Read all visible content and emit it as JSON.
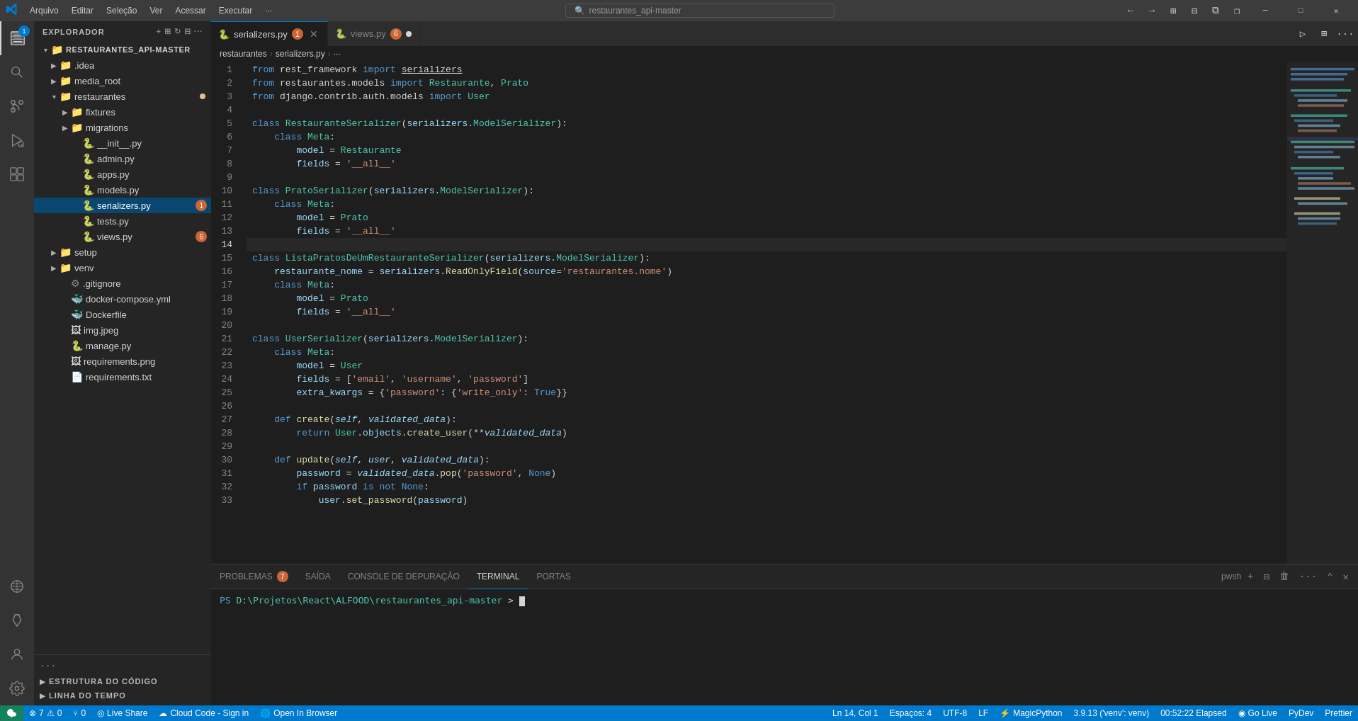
{
  "titlebar": {
    "logo": "⬡",
    "menu_items": [
      "Arquivo",
      "Editar",
      "Seleção",
      "Ver",
      "Acessar",
      "Executar",
      "···"
    ],
    "search_placeholder": "restaurantes_api-master",
    "back_label": "←",
    "forward_label": "→",
    "controls": [
      "⊞",
      "⊟",
      "⧉",
      "❐"
    ],
    "minimize": "─",
    "maximize": "□",
    "close": "✕"
  },
  "activity_bar": {
    "items": [
      {
        "name": "explorer",
        "icon": "⊡",
        "active": true,
        "badge": "1"
      },
      {
        "name": "search",
        "icon": "🔍",
        "active": false
      },
      {
        "name": "source-control",
        "icon": "⑂",
        "active": false
      },
      {
        "name": "run-debug",
        "icon": "▷",
        "active": false
      },
      {
        "name": "extensions",
        "icon": "⊞",
        "active": false
      },
      {
        "name": "remote",
        "icon": "◎",
        "active": false
      },
      {
        "name": "testing",
        "icon": "⚗",
        "active": false
      },
      {
        "name": "accounts",
        "icon": "◉",
        "active": false
      },
      {
        "name": "settings",
        "icon": "⚙",
        "active": false
      }
    ]
  },
  "sidebar": {
    "title": "EXPLORADOR",
    "root_folder": "RESTAURANTES_API-MASTER",
    "tree": [
      {
        "id": "idea",
        "label": ".idea",
        "type": "folder",
        "indent": 1,
        "expanded": false
      },
      {
        "id": "media_root",
        "label": "media_root",
        "type": "folder",
        "indent": 1,
        "expanded": false
      },
      {
        "id": "restaurantes",
        "label": "restaurantes",
        "type": "folder",
        "indent": 1,
        "expanded": true,
        "dot": true
      },
      {
        "id": "fixtures",
        "label": "fixtures",
        "type": "folder",
        "indent": 2,
        "expanded": false
      },
      {
        "id": "migrations",
        "label": "migrations",
        "type": "folder",
        "indent": 2,
        "expanded": false
      },
      {
        "id": "__init__",
        "label": "__init__.py",
        "type": "py",
        "indent": 2
      },
      {
        "id": "admin",
        "label": "admin.py",
        "type": "py",
        "indent": 2
      },
      {
        "id": "apps",
        "label": "apps.py",
        "type": "py",
        "indent": 2
      },
      {
        "id": "models",
        "label": "models.py",
        "type": "py",
        "indent": 2
      },
      {
        "id": "serializers",
        "label": "serializers.py",
        "type": "py",
        "indent": 2,
        "badge": "1",
        "selected": true
      },
      {
        "id": "tests",
        "label": "tests.py",
        "type": "py",
        "indent": 2
      },
      {
        "id": "views",
        "label": "views.py",
        "type": "py",
        "indent": 2,
        "badge": "6"
      },
      {
        "id": "setup",
        "label": "setup",
        "type": "folder",
        "indent": 1,
        "expanded": false
      },
      {
        "id": "venv",
        "label": "venv",
        "type": "folder",
        "indent": 1,
        "expanded": false
      },
      {
        "id": "gitignore",
        "label": ".gitignore",
        "type": "git",
        "indent": 1
      },
      {
        "id": "docker-compose",
        "label": "docker-compose.yml",
        "type": "docker",
        "indent": 1
      },
      {
        "id": "dockerfile",
        "label": "Dockerfile",
        "type": "docker",
        "indent": 1
      },
      {
        "id": "img",
        "label": "img.jpeg",
        "type": "img",
        "indent": 1
      },
      {
        "id": "manage",
        "label": "manage.py",
        "type": "py",
        "indent": 1
      },
      {
        "id": "requirements-png",
        "label": "requirements.png",
        "type": "img",
        "indent": 1
      },
      {
        "id": "requirements-txt",
        "label": "requirements.txt",
        "type": "txt",
        "indent": 1
      }
    ],
    "bottom_sections": [
      {
        "id": "code-structure",
        "label": "ESTRUTURA DO CÓDIGO",
        "expanded": false
      },
      {
        "id": "timeline",
        "label": "LINHA DO TEMPO",
        "expanded": false
      }
    ]
  },
  "tabs": [
    {
      "id": "serializers",
      "label": "serializers.py",
      "badge": "1",
      "active": true,
      "icon": "🐍"
    },
    {
      "id": "views",
      "label": "views.py",
      "badge": "6",
      "active": false,
      "icon": "🐍",
      "dot": true
    }
  ],
  "breadcrumb": {
    "items": [
      "restaurantes",
      "serializers.py",
      "···"
    ]
  },
  "editor": {
    "current_line": 14,
    "lines": [
      {
        "num": 1,
        "code": "from rest_framework import <u>serializers</u>"
      },
      {
        "num": 2,
        "code": "from restaurantes.models import Restaurante, Prato"
      },
      {
        "num": 3,
        "code": "from django.contrib.auth.models import User"
      },
      {
        "num": 4,
        "code": ""
      },
      {
        "num": 5,
        "code": "class RestauranteSerializer(serializers.ModelSerializer):"
      },
      {
        "num": 6,
        "code": "    class Meta:"
      },
      {
        "num": 7,
        "code": "        model = Restaurante"
      },
      {
        "num": 8,
        "code": "        fields = '__all__'"
      },
      {
        "num": 9,
        "code": ""
      },
      {
        "num": 10,
        "code": "class PratoSerializer(serializers.ModelSerializer):"
      },
      {
        "num": 11,
        "code": "    class Meta:"
      },
      {
        "num": 12,
        "code": "        model = Prato"
      },
      {
        "num": 13,
        "code": "        fields = '__all__'"
      },
      {
        "num": 14,
        "code": ""
      },
      {
        "num": 15,
        "code": "class ListaPratosDeUmRestauranteSerializer(serializers.ModelSerializer):"
      },
      {
        "num": 16,
        "code": "    restaurante_nome = serializers.ReadOnlyField(source='restaurantes.nome')"
      },
      {
        "num": 17,
        "code": "    class Meta:"
      },
      {
        "num": 18,
        "code": "        model = Prato"
      },
      {
        "num": 19,
        "code": "        fields = '__all__'"
      },
      {
        "num": 20,
        "code": ""
      },
      {
        "num": 21,
        "code": "class UserSerializer(serializers.ModelSerializer):"
      },
      {
        "num": 22,
        "code": "    class Meta:"
      },
      {
        "num": 23,
        "code": "        model = User"
      },
      {
        "num": 24,
        "code": "        fields = ['email', 'username', 'password']"
      },
      {
        "num": 25,
        "code": "        extra_kwargs = {'password': {'write_only': True}}"
      },
      {
        "num": 26,
        "code": ""
      },
      {
        "num": 27,
        "code": "    def create(self, validated_data):"
      },
      {
        "num": 28,
        "code": "        return User.objects.create_user(**validated_data)"
      },
      {
        "num": 29,
        "code": ""
      },
      {
        "num": 30,
        "code": "    def update(self, user, validated_data):"
      },
      {
        "num": 31,
        "code": "        password = validated_data.pop('password', None)"
      },
      {
        "num": 32,
        "code": "        if password is not None:"
      },
      {
        "num": 33,
        "code": "            user.set_password(password)"
      }
    ]
  },
  "panel": {
    "tabs": [
      {
        "id": "problems",
        "label": "PROBLEMAS",
        "badge": "7"
      },
      {
        "id": "output",
        "label": "SAÍDA"
      },
      {
        "id": "debug-console",
        "label": "CONSOLE DE DEPURAÇÃO"
      },
      {
        "id": "terminal",
        "label": "TERMINAL",
        "active": true
      },
      {
        "id": "ports",
        "label": "PORTAS"
      }
    ],
    "terminal_shell": "pwsh",
    "terminal_content": "PS D:\\Projetos\\React\\ALFOOD\\restaurantes_api-master>"
  },
  "status_bar": {
    "left_items": [
      {
        "id": "remote",
        "icon": "⬡",
        "label": "",
        "bg": "#16825d"
      },
      {
        "id": "errors",
        "icon": "⊗",
        "label": "7",
        "extra": "⚠",
        "extra_label": "0"
      },
      {
        "id": "source-control",
        "icon": "⑂",
        "label": "0"
      }
    ],
    "right_items": [
      {
        "id": "cursor",
        "label": "Ln 14, Col 1"
      },
      {
        "id": "spaces",
        "label": "Espaços: 4"
      },
      {
        "id": "encoding",
        "label": "UTF-8"
      },
      {
        "id": "eol",
        "label": "LF"
      },
      {
        "id": "language",
        "icon": "⚡",
        "label": "MagicPython"
      },
      {
        "id": "python-version",
        "label": "3.9.13 ('venv': venv)"
      },
      {
        "id": "clock",
        "label": "00:52:22 Elapsed"
      },
      {
        "id": "go-live",
        "icon": "◉",
        "label": "Go Live"
      },
      {
        "id": "pydev",
        "label": "PyDev"
      },
      {
        "id": "prettier",
        "label": "Prettier"
      }
    ],
    "live_share": "Live Share"
  }
}
